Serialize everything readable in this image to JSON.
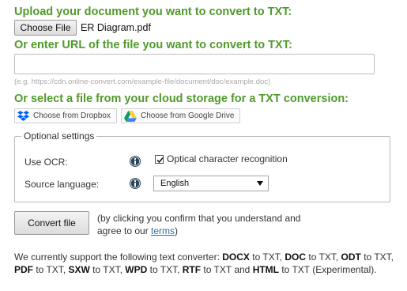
{
  "upload": {
    "heading": "Upload your document you want to convert to TXT:",
    "choose_file_label": "Choose File",
    "file_name": "ER Diagram.pdf"
  },
  "url": {
    "heading": "Or enter URL of the file you want to convert to TXT:",
    "value": "",
    "example": "(e.g. https://cdn.online-convert.com/example-file/document/doc/example.doc)"
  },
  "cloud": {
    "heading": "Or select a file from your cloud storage for a TXT conversion:",
    "dropbox_label": "Choose from Dropbox",
    "gdrive_label": "Choose from Google Drive"
  },
  "optional_settings": {
    "legend": "Optional settings",
    "ocr_label": "Use OCR:",
    "ocr_checkbox_label": "Optical character recognition",
    "ocr_checked": true,
    "source_language_label": "Source language:",
    "source_language_value": "English"
  },
  "convert": {
    "button_label": "Convert file",
    "note_before": "(by clicking you confirm that you understand and agree to our ",
    "terms_link": "terms",
    "note_after": ")"
  },
  "support": {
    "intro": "We currently support the following text converter: ",
    "items": [
      {
        "format": "DOCX",
        "rest": " to TXT, "
      },
      {
        "format": "DOC",
        "rest": " to TXT, "
      },
      {
        "format": "ODT",
        "rest": " to TXT, "
      },
      {
        "format": "PDF",
        "rest": " to TXT, "
      },
      {
        "format": "SXW",
        "rest": " to TXT, "
      },
      {
        "format": "WPD",
        "rest": " to TXT, "
      },
      {
        "format": "RTF",
        "rest": " to TXT and "
      },
      {
        "format": "HTML",
        "rest": " to TXT (Experimental)."
      }
    ]
  },
  "colors": {
    "heading_green": "#4f9a2a",
    "info_icon": "#2a4457",
    "link_blue": "#2e6da4",
    "dropbox_blue": "#0061fe"
  },
  "icons": {
    "dropbox": "dropbox-icon",
    "gdrive": "google-drive-icon",
    "info": "info-icon",
    "select_arrow": "caret-down-icon"
  }
}
